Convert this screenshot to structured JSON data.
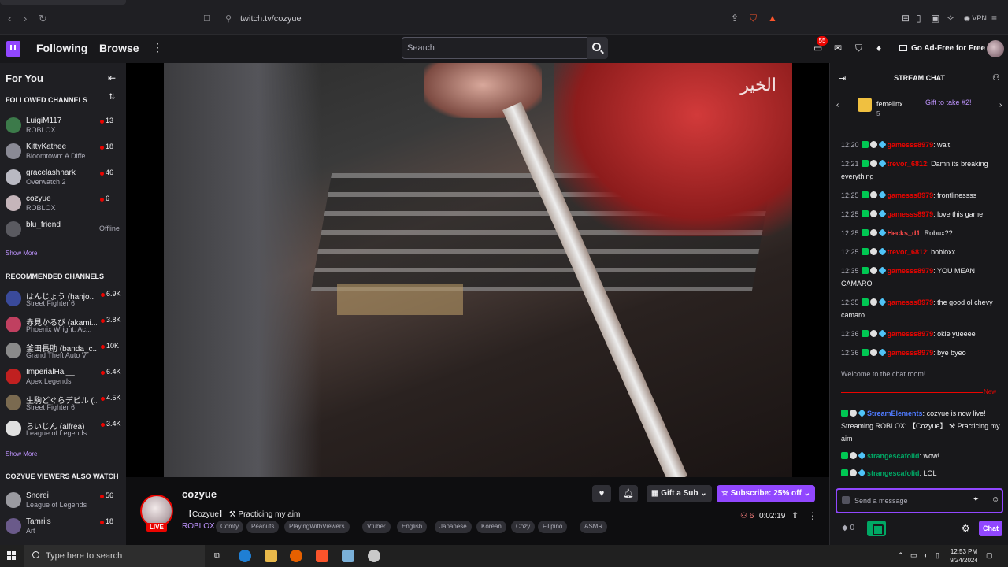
{
  "browser": {
    "url": "twitch.tv/cozyue",
    "vpn_label": "VPN"
  },
  "topnav": {
    "following": "Following",
    "browse": "Browse",
    "search_placeholder": "Search",
    "notifications_count": "55",
    "adfree_label": "Go Ad-Free for Free"
  },
  "sidebar": {
    "title": "For You",
    "followed_header": "FOLLOWED CHANNELS",
    "followed": [
      {
        "name": "LuigiM117",
        "game": "ROBLOX",
        "viewers": "13",
        "live": true,
        "color": "#3c7a4a"
      },
      {
        "name": "KittyKathee",
        "game": "Bloomtown: A Diffe...",
        "viewers": "18",
        "live": true,
        "color": "#8a8a95"
      },
      {
        "name": "gracelashnark",
        "game": "Overwatch 2",
        "viewers": "46",
        "live": true,
        "color": "#b9b9c2"
      },
      {
        "name": "cozyue",
        "game": "ROBLOX",
        "viewers": "6",
        "live": true,
        "color": "#c5b5ba"
      },
      {
        "name": "blu_friend",
        "game": "",
        "viewers": "Offline",
        "live": false,
        "color": "#5a5a60"
      }
    ],
    "show_more_1": "Show More",
    "recommended_header": "RECOMMENDED CHANNELS",
    "recommended": [
      {
        "name": "はんじょう (hanjo...",
        "game": "Street Fighter 6",
        "viewers": "6.9K",
        "color": "#3a4a9a"
      },
      {
        "name": "赤見かるび (akami...",
        "game": "Phoenix Wright: Ac...",
        "viewers": "3.8K",
        "color": "#c04060"
      },
      {
        "name": "釜田長助 (banda_c...",
        "game": "Grand Theft Auto V",
        "viewers": "10K",
        "color": "#8a8a8a"
      },
      {
        "name": "ImperialHal__",
        "game": "Apex Legends",
        "viewers": "6.4K",
        "color": "#c02020"
      },
      {
        "name": "生駒どぐらデビル (...",
        "game": "Street Fighter 6",
        "viewers": "4.5K",
        "color": "#7a6a50"
      },
      {
        "name": "らいじん (alfrea)",
        "game": "League of Legends",
        "viewers": "3.4K",
        "color": "#e0e0e0"
      }
    ],
    "show_more_2": "Show More",
    "viewers_also_header": "COZYUE VIEWERS ALSO WATCH",
    "also_watch": [
      {
        "name": "Snorei",
        "game": "League of Legends",
        "viewers": "56",
        "color": "#9a9aa0"
      },
      {
        "name": "Tamriis",
        "game": "Art",
        "viewers": "18",
        "color": "#6a5a8a"
      }
    ]
  },
  "video": {
    "watermark": "الخير"
  },
  "stream": {
    "streamer": "cozyue",
    "live_label": "LIVE",
    "title": "【Cozyue】 ⚒ Practicing my aim",
    "category": "ROBLOX",
    "tags": [
      "Comfy",
      "Peanuts",
      "PlayingWithViewers",
      "Vtuber",
      "English",
      "Japanese",
      "Korean",
      "Cozy",
      "Filipino",
      "ASMR"
    ],
    "gift_label": "Gift a Sub",
    "subscribe_label": "Subscribe: 25% off",
    "viewer_count": "6",
    "uptime": "0:02:19"
  },
  "chat": {
    "title": "STREAM CHAT",
    "gift_user": "femelinx",
    "gift_count": "5",
    "gift_goal": "Gift to take #2!",
    "messages": [
      {
        "time": "12:20",
        "user": "gamesss8979",
        "user_color": "#eb0400",
        "text": "wait"
      },
      {
        "time": "12:21",
        "user": "trevor_6812",
        "user_color": "#eb0400",
        "text": "Damn its breaking everything"
      },
      {
        "time": "12:25",
        "user": "gamesss8979",
        "user_color": "#eb0400",
        "text": "frontlinessss"
      },
      {
        "time": "12:25",
        "user": "gamesss8979",
        "user_color": "#eb0400",
        "text": "love this game"
      },
      {
        "time": "12:25",
        "user": "Hecks_d1",
        "user_color": "#ff4a4a",
        "text": "Robux??"
      },
      {
        "time": "12:25",
        "user": "trevor_6812",
        "user_color": "#eb0400",
        "text": "bobloxx"
      },
      {
        "time": "12:35",
        "user": "gamesss8979",
        "user_color": "#eb0400",
        "text": "YOU MEAN CAMARO"
      },
      {
        "time": "12:35",
        "user": "gamesss8979",
        "user_color": "#eb0400",
        "text": "the good ol chevy camaro"
      },
      {
        "time": "12:36",
        "user": "gamesss8979",
        "user_color": "#eb0400",
        "text": "okie yueeee"
      },
      {
        "time": "12:36",
        "user": "gamesss8979",
        "user_color": "#eb0400",
        "text": "bye byeo"
      }
    ],
    "welcome": "Welcome to the chat room!",
    "new_label": "New",
    "recent": [
      {
        "user": "StreamElements",
        "user_color": "#4f7bff",
        "text": "cozyue is now live! Streaming ROBLOX: 【Cozyue】 ⚒ Practicing my aim"
      },
      {
        "user": "strangescafolid",
        "user_color": "#00a865",
        "text": "wow!"
      },
      {
        "user": "strangescafolid",
        "user_color": "#00a865",
        "text": "LOL"
      }
    ],
    "input_placeholder": "Send a message",
    "points": "0",
    "send_label": "Chat"
  },
  "taskbar": {
    "search_placeholder": "Type here to search",
    "time": "12:53 PM",
    "date": "9/24/2024"
  }
}
